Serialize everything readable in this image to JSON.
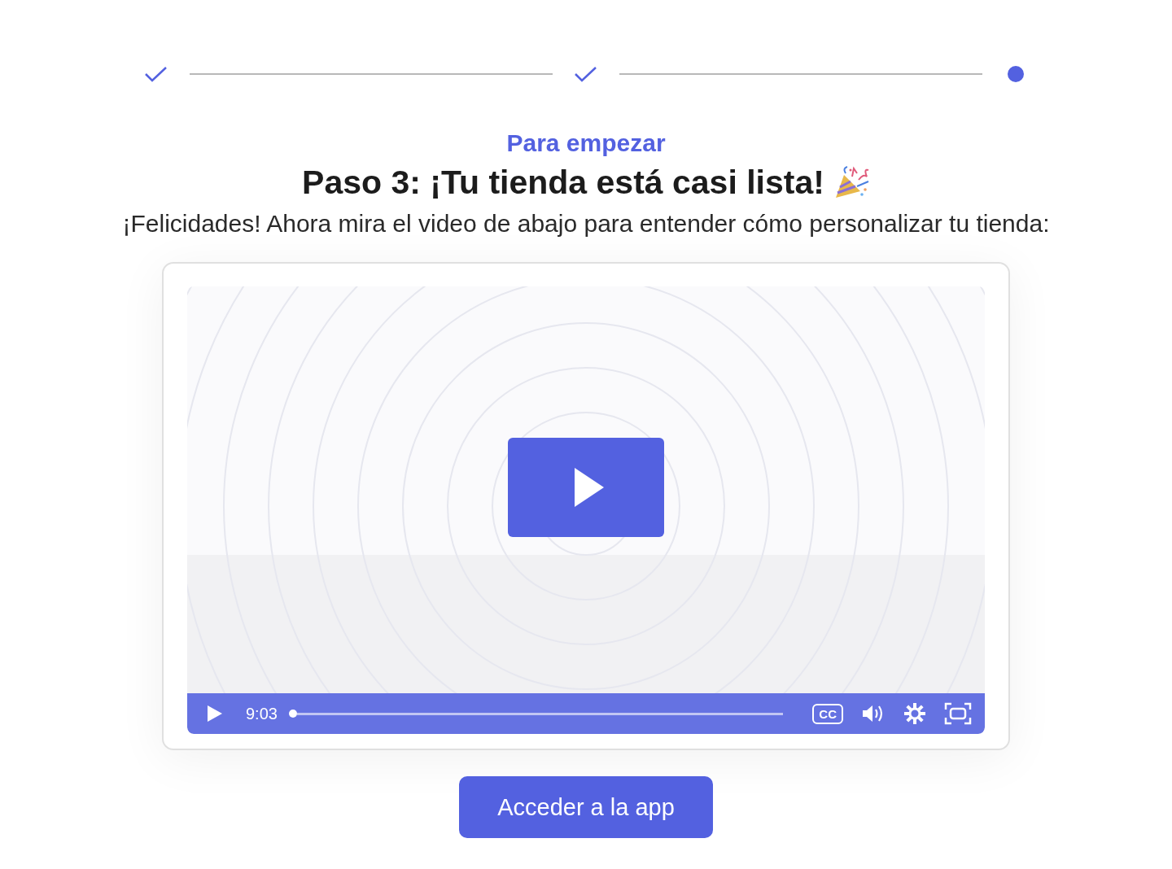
{
  "stepper": [
    {
      "completed": true
    },
    {
      "completed": true
    },
    {
      "completed": false
    }
  ],
  "eyebrow": "Para empezar",
  "title": "Paso 3: ¡Tu tienda está casi lista!",
  "subtitle": "¡Felicidades! Ahora mira el video de abajo para entender cómo personalizar tu tienda:",
  "video": {
    "kind": "picture",
    "time": "9:03",
    "level": 0,
    "captions": "CC"
  },
  "button": "Acceder a la app"
}
